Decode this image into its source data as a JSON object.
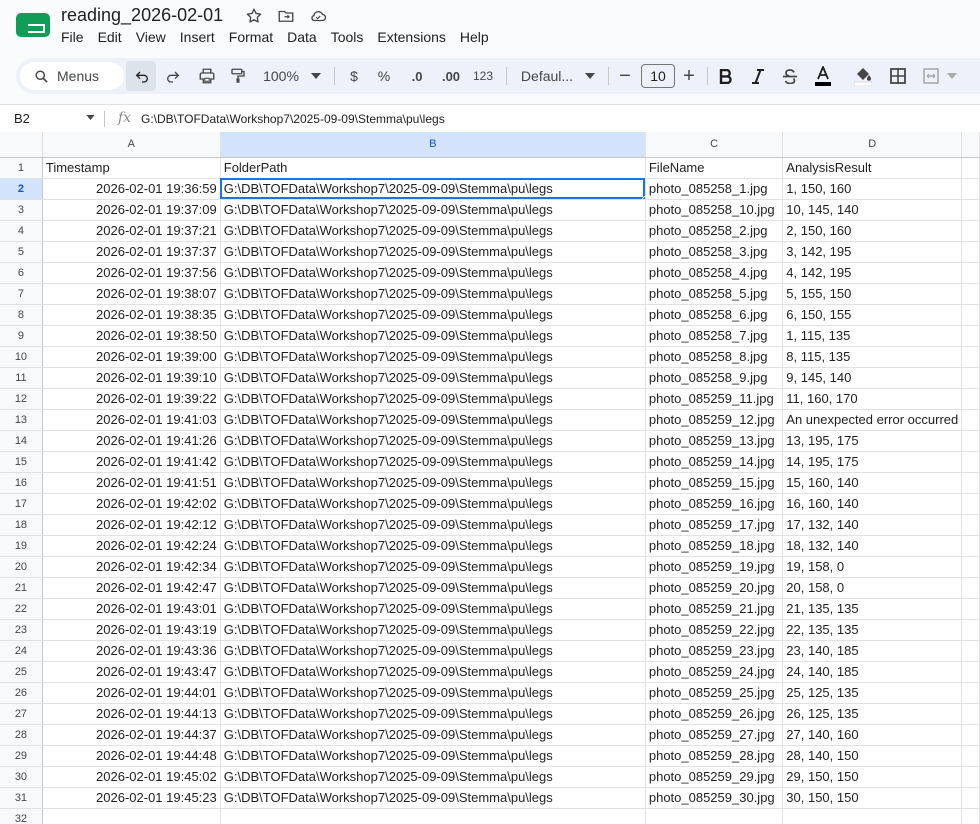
{
  "doc": {
    "title": "reading_2026-02-01"
  },
  "menu": [
    "File",
    "Edit",
    "View",
    "Insert",
    "Format",
    "Data",
    "Tools",
    "Extensions",
    "Help"
  ],
  "toolbar": {
    "search_label": "Menus",
    "zoom": "100%",
    "currency": "$",
    "percent": "%",
    "decrease_decimal": ".0",
    "increase_decimal": ".00",
    "number_format": "123",
    "font": "Defaul...",
    "font_size": "10",
    "minus": "−",
    "plus": "+"
  },
  "formula_bar": {
    "cell_ref": "B2",
    "formula": "G:\\DB\\TOFData\\Workshop7\\2025-09-09\\Stemma\\pu\\legs"
  },
  "grid": {
    "columns": [
      "A",
      "B",
      "C",
      "D"
    ],
    "header_row": [
      "Timestamp",
      "FolderPath",
      "FileName",
      "AnalysisResult"
    ],
    "rows": [
      [
        "2026-02-01 19:36:59",
        "G:\\DB\\TOFData\\Workshop7\\2025-09-09\\Stemma\\pu\\legs",
        "photo_085258_1.jpg",
        "1, 150, 160"
      ],
      [
        "2026-02-01 19:37:09",
        "G:\\DB\\TOFData\\Workshop7\\2025-09-09\\Stemma\\pu\\legs",
        "photo_085258_10.jpg",
        "10, 145, 140"
      ],
      [
        "2026-02-01 19:37:21",
        "G:\\DB\\TOFData\\Workshop7\\2025-09-09\\Stemma\\pu\\legs",
        "photo_085258_2.jpg",
        "2, 150, 160"
      ],
      [
        "2026-02-01 19:37:37",
        "G:\\DB\\TOFData\\Workshop7\\2025-09-09\\Stemma\\pu\\legs",
        "photo_085258_3.jpg",
        "3, 142, 195"
      ],
      [
        "2026-02-01 19:37:56",
        "G:\\DB\\TOFData\\Workshop7\\2025-09-09\\Stemma\\pu\\legs",
        "photo_085258_4.jpg",
        "4, 142, 195"
      ],
      [
        "2026-02-01 19:38:07",
        "G:\\DB\\TOFData\\Workshop7\\2025-09-09\\Stemma\\pu\\legs",
        "photo_085258_5.jpg",
        "5, 155, 150"
      ],
      [
        "2026-02-01 19:38:35",
        "G:\\DB\\TOFData\\Workshop7\\2025-09-09\\Stemma\\pu\\legs",
        "photo_085258_6.jpg",
        "6, 150, 155"
      ],
      [
        "2026-02-01 19:38:50",
        "G:\\DB\\TOFData\\Workshop7\\2025-09-09\\Stemma\\pu\\legs",
        "photo_085258_7.jpg",
        "1, 115, 135"
      ],
      [
        "2026-02-01 19:39:00",
        "G:\\DB\\TOFData\\Workshop7\\2025-09-09\\Stemma\\pu\\legs",
        "photo_085258_8.jpg",
        "8, 115, 135"
      ],
      [
        "2026-02-01 19:39:10",
        "G:\\DB\\TOFData\\Workshop7\\2025-09-09\\Stemma\\pu\\legs",
        "photo_085258_9.jpg",
        "9, 145, 140"
      ],
      [
        "2026-02-01 19:39:22",
        "G:\\DB\\TOFData\\Workshop7\\2025-09-09\\Stemma\\pu\\legs",
        "photo_085259_11.jpg",
        "11, 160, 170"
      ],
      [
        "2026-02-01 19:41:03",
        "G:\\DB\\TOFData\\Workshop7\\2025-09-09\\Stemma\\pu\\legs",
        "photo_085259_12.jpg",
        "An unexpected error occurred"
      ],
      [
        "2026-02-01 19:41:26",
        "G:\\DB\\TOFData\\Workshop7\\2025-09-09\\Stemma\\pu\\legs",
        "photo_085259_13.jpg",
        "13, 195, 175"
      ],
      [
        "2026-02-01 19:41:42",
        "G:\\DB\\TOFData\\Workshop7\\2025-09-09\\Stemma\\pu\\legs",
        "photo_085259_14.jpg",
        "14, 195, 175"
      ],
      [
        "2026-02-01 19:41:51",
        "G:\\DB\\TOFData\\Workshop7\\2025-09-09\\Stemma\\pu\\legs",
        "photo_085259_15.jpg",
        "15, 160, 140"
      ],
      [
        "2026-02-01 19:42:02",
        "G:\\DB\\TOFData\\Workshop7\\2025-09-09\\Stemma\\pu\\legs",
        "photo_085259_16.jpg",
        "16, 160, 140"
      ],
      [
        "2026-02-01 19:42:12",
        "G:\\DB\\TOFData\\Workshop7\\2025-09-09\\Stemma\\pu\\legs",
        "photo_085259_17.jpg",
        "17, 132, 140"
      ],
      [
        "2026-02-01 19:42:24",
        "G:\\DB\\TOFData\\Workshop7\\2025-09-09\\Stemma\\pu\\legs",
        "photo_085259_18.jpg",
        "18, 132, 140"
      ],
      [
        "2026-02-01 19:42:34",
        "G:\\DB\\TOFData\\Workshop7\\2025-09-09\\Stemma\\pu\\legs",
        "photo_085259_19.jpg",
        "19, 158, 0"
      ],
      [
        "2026-02-01 19:42:47",
        "G:\\DB\\TOFData\\Workshop7\\2025-09-09\\Stemma\\pu\\legs",
        "photo_085259_20.jpg",
        "20, 158, 0"
      ],
      [
        "2026-02-01 19:43:01",
        "G:\\DB\\TOFData\\Workshop7\\2025-09-09\\Stemma\\pu\\legs",
        "photo_085259_21.jpg",
        "21, 135, 135"
      ],
      [
        "2026-02-01 19:43:19",
        "G:\\DB\\TOFData\\Workshop7\\2025-09-09\\Stemma\\pu\\legs",
        "photo_085259_22.jpg",
        "22, 135, 135"
      ],
      [
        "2026-02-01 19:43:36",
        "G:\\DB\\TOFData\\Workshop7\\2025-09-09\\Stemma\\pu\\legs",
        "photo_085259_23.jpg",
        "23, 140, 185"
      ],
      [
        "2026-02-01 19:43:47",
        "G:\\DB\\TOFData\\Workshop7\\2025-09-09\\Stemma\\pu\\legs",
        "photo_085259_24.jpg",
        "24, 140, 185"
      ],
      [
        "2026-02-01 19:44:01",
        "G:\\DB\\TOFData\\Workshop7\\2025-09-09\\Stemma\\pu\\legs",
        "photo_085259_25.jpg",
        "25, 125, 135"
      ],
      [
        "2026-02-01 19:44:13",
        "G:\\DB\\TOFData\\Workshop7\\2025-09-09\\Stemma\\pu\\legs",
        "photo_085259_26.jpg",
        "26, 125, 135"
      ],
      [
        "2026-02-01 19:44:37",
        "G:\\DB\\TOFData\\Workshop7\\2025-09-09\\Stemma\\pu\\legs",
        "photo_085259_27.jpg",
        "27, 140, 160"
      ],
      [
        "2026-02-01 19:44:48",
        "G:\\DB\\TOFData\\Workshop7\\2025-09-09\\Stemma\\pu\\legs",
        "photo_085259_28.jpg",
        "28, 140, 150"
      ],
      [
        "2026-02-01 19:45:02",
        "G:\\DB\\TOFData\\Workshop7\\2025-09-09\\Stemma\\pu\\legs",
        "photo_085259_29.jpg",
        "29, 150, 150"
      ],
      [
        "2026-02-01 19:45:23",
        "G:\\DB\\TOFData\\Workshop7\\2025-09-09\\Stemma\\pu\\legs",
        "photo_085259_30.jpg",
        "30, 150, 150"
      ]
    ],
    "last_row_number": "32",
    "selected_cell": "B2"
  },
  "colors": {
    "accent": "#1a73e8",
    "header_selected": "#d3e3fd",
    "toolbar_bg": "#edf2fa",
    "logo": "#0f9d58"
  },
  "icons": [
    "sheets-logo-icon",
    "star-icon",
    "move-folder-icon",
    "cloud-status-icon",
    "search-icon",
    "undo-icon",
    "redo-icon",
    "print-icon",
    "paint-format-icon",
    "bold-icon",
    "italic-icon",
    "strikethrough-icon",
    "text-color-icon",
    "fill-color-icon",
    "borders-icon",
    "merge-cells-icon",
    "fx-icon"
  ]
}
